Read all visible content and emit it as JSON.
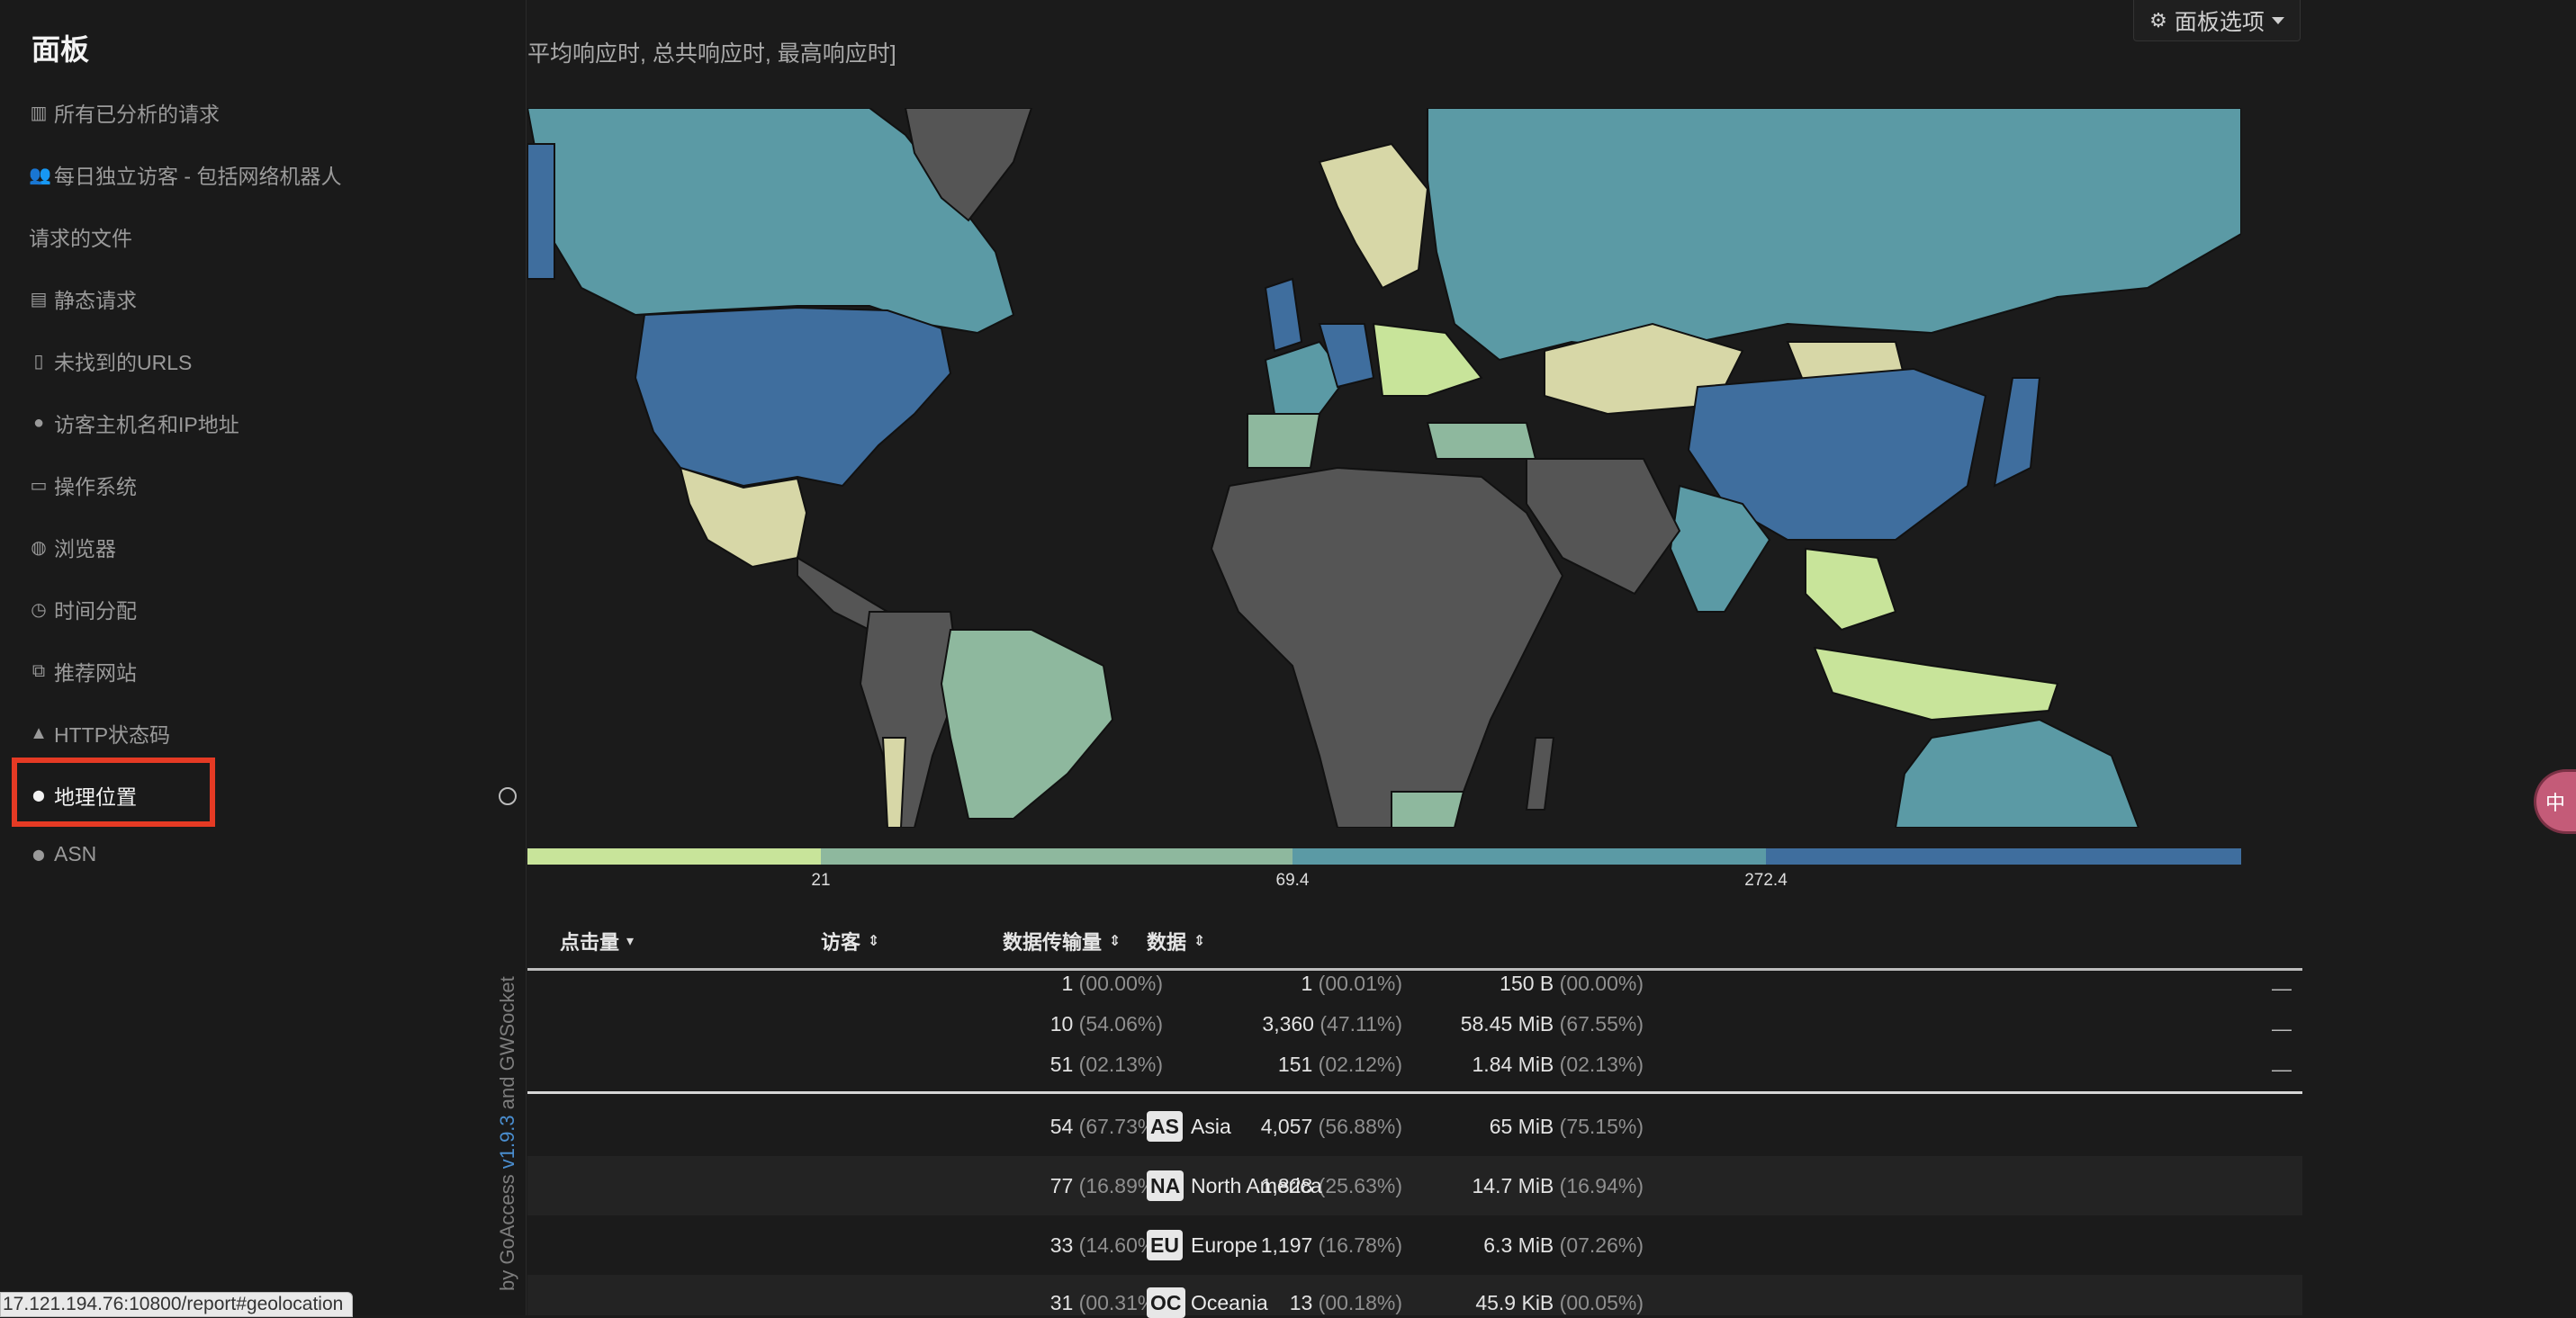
{
  "sidebar": {
    "title": "面板",
    "items": [
      {
        "icon": "bar-chart-icon",
        "glyph": "▥",
        "label": "所有已分析的请求"
      },
      {
        "icon": "users-icon",
        "glyph": "👥",
        "label": "每日独立访客 - 包括网络机器人"
      },
      {
        "icon": "",
        "glyph": "",
        "label": "请求的文件"
      },
      {
        "icon": "file-text-icon",
        "glyph": "▤",
        "label": "静态请求"
      },
      {
        "icon": "file-icon",
        "glyph": "▯",
        "label": "未找到的URLS"
      },
      {
        "icon": "user-icon",
        "glyph": "●",
        "label": "访客主机名和IP地址"
      },
      {
        "icon": "desktop-icon",
        "glyph": "▭",
        "label": "操作系统"
      },
      {
        "icon": "chrome-icon",
        "glyph": "◍",
        "label": "浏览器"
      },
      {
        "icon": "clock-icon",
        "glyph": "◷",
        "label": "时间分配"
      },
      {
        "icon": "external-link-icon",
        "glyph": "⧉",
        "label": "推荐网站"
      },
      {
        "icon": "warning-icon",
        "glyph": "▲",
        "label": "HTTP状态码"
      },
      {
        "icon": "map-marker-icon",
        "glyph": "⬤",
        "label": "地理位置",
        "active": true
      },
      {
        "icon": "map-marker-icon",
        "glyph": "⬤",
        "label": "ASN"
      }
    ],
    "credit": {
      "prefix": "by GoAccess ",
      "version": "v1.9.3",
      "suffix": " and GWSocket"
    }
  },
  "header": {
    "subtitle": "平均响应时, 总共响应时, 最高响应时]",
    "panel_options_label": "面板选项"
  },
  "map_legend": {
    "thresholds": [
      "21",
      "69.4",
      "272.4"
    ],
    "colors": [
      "#c8e49a",
      "#8eb89e",
      "#5b9aa5",
      "#3f6e9e"
    ]
  },
  "table": {
    "columns": {
      "hits": "点击量",
      "visitors": "访客",
      "bandwidth": "数据传输量",
      "data": "数据"
    },
    "summary": [
      {
        "hits": "1",
        "hits_pct": "(00.00%)",
        "visitors": "1",
        "visitors_pct": "(00.01%)",
        "bw": "150 B",
        "bw_pct": "(00.00%)",
        "dash": "—"
      },
      {
        "hits": "10",
        "hits_pct": "(54.06%)",
        "visitors": "3,360",
        "visitors_pct": "(47.11%)",
        "bw": "58.45 MiB",
        "bw_pct": "(67.55%)",
        "dash": "—"
      },
      {
        "hits": "51",
        "hits_pct": "(02.13%)",
        "visitors": "151",
        "visitors_pct": "(02.12%)",
        "bw": "1.84 MiB",
        "bw_pct": "(02.13%)",
        "dash": "—"
      }
    ],
    "rows": [
      {
        "hits": "54",
        "hits_pct": "(67.73%)",
        "visitors": "4,057",
        "visitors_pct": "(56.88%)",
        "bw": "65 MiB",
        "bw_pct": "(75.15%)",
        "code": "AS",
        "name": "Asia"
      },
      {
        "hits": "77",
        "hits_pct": "(16.89%)",
        "visitors": "1,828",
        "visitors_pct": "(25.63%)",
        "bw": "14.7 MiB",
        "bw_pct": "(16.94%)",
        "code": "NA",
        "name": "North America"
      },
      {
        "hits": "33",
        "hits_pct": "(14.60%)",
        "visitors": "1,197",
        "visitors_pct": "(16.78%)",
        "bw": "6.3 MiB",
        "bw_pct": "(07.26%)",
        "code": "EU",
        "name": "Europe"
      },
      {
        "hits": "31",
        "hits_pct": "(00.31%)",
        "visitors": "13",
        "visitors_pct": "(00.18%)",
        "bw": "45.9 KiB",
        "bw_pct": "(00.05%)",
        "code": "OC",
        "name": "Oceania"
      }
    ]
  },
  "status_url": "17.121.194.76:10800/report#geolocation",
  "float_badge": "中"
}
